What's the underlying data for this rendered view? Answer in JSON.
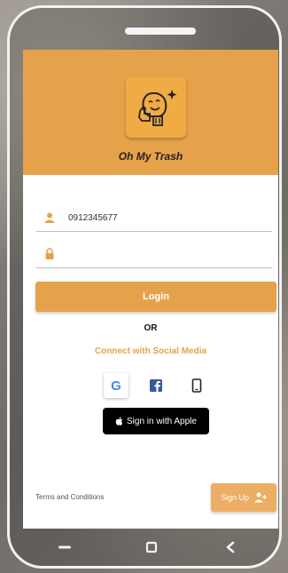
{
  "app": {
    "name": "Oh My Trash"
  },
  "login": {
    "phone_value": "0912345677",
    "password_value": "",
    "login_label": "Login"
  },
  "divider": {
    "or_label": "OR"
  },
  "social": {
    "title": "Connect with Social Media",
    "providers": [
      "google-icon",
      "facebook-icon",
      "mobile-phone-icon"
    ],
    "apple_label": "Sign in with Apple"
  },
  "footer": {
    "terms_label": "Terms and Conditions",
    "signup_label": "Sign Up"
  },
  "colors": {
    "accent": "#e6a24a",
    "social_text": "#e6a24a",
    "apple_button": "#000000"
  },
  "nav_icons": [
    "menu-back-icon",
    "home-square-icon",
    "back-chevron-icon"
  ]
}
